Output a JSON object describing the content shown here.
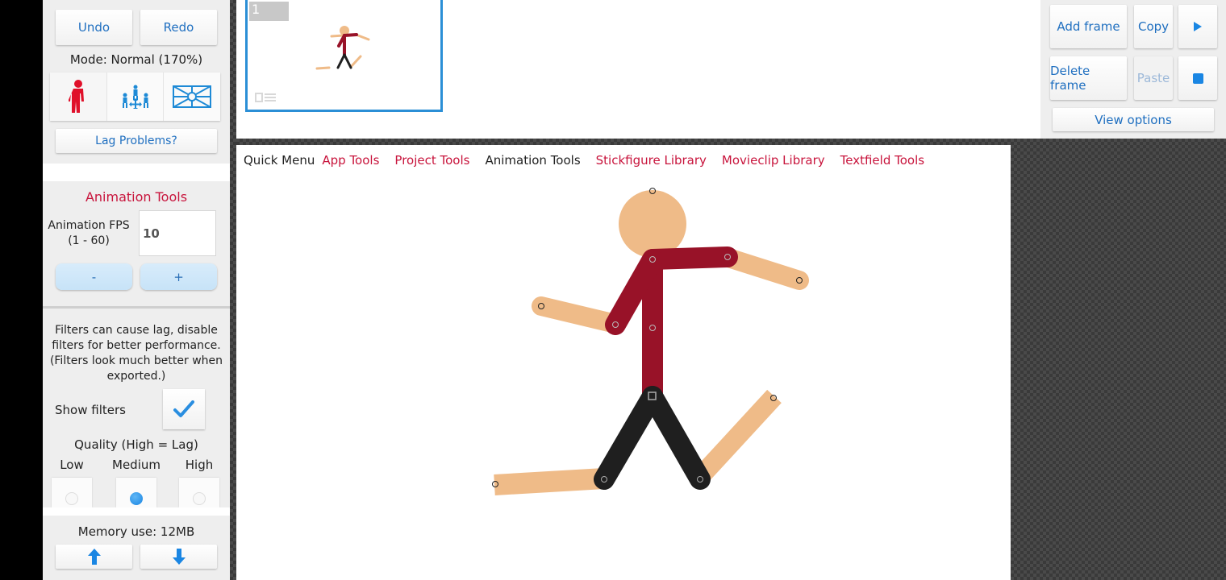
{
  "sidebar": {
    "undo_label": "Undo",
    "redo_label": "Redo",
    "mode_text": "Mode: Normal (170%)",
    "mode_buttons": [
      {
        "name": "stickfigure-mode",
        "icon": "stickfigure-icon",
        "active": true
      },
      {
        "name": "group-mode",
        "icon": "group-move-icon",
        "active": false
      },
      {
        "name": "background-mode",
        "icon": "background-scene-icon",
        "active": false
      }
    ],
    "lag_label": "Lag Problems?",
    "animation_tools": {
      "title": "Animation Tools",
      "fps_label_line1": "Animation FPS",
      "fps_label_line2": "(1 - 60)",
      "fps_value": "10",
      "minus_label": "-",
      "plus_label": "+"
    },
    "filters": {
      "note_line1": "Filters can cause lag, disable",
      "note_line2": "filters for better performance.",
      "note_line3": "(Filters look much better when",
      "note_line4": "exported.)",
      "show_filters_label": "Show filters",
      "show_filters_checked": true,
      "quality_label": "Quality (High = Lag)",
      "quality_options": [
        "Low",
        "Medium",
        "High"
      ],
      "quality_selected": "Medium"
    },
    "memory_text": "Memory use: 12MB",
    "up_icon": "arrow-up-icon",
    "down_icon": "arrow-down-icon"
  },
  "frames": {
    "items": [
      {
        "number": "1",
        "selected": true
      }
    ]
  },
  "top_right": {
    "add_frame_label": "Add frame",
    "copy_label": "Copy",
    "play_icon": "play-icon",
    "delete_frame_label": "Delete frame",
    "paste_label": "Paste",
    "stop_icon": "stop-icon",
    "view_options_label": "View options"
  },
  "menu": {
    "quick_menu": "Quick Menu",
    "items": [
      {
        "label": "App Tools",
        "active": false
      },
      {
        "label": "Project Tools",
        "active": false
      },
      {
        "label": "Animation Tools",
        "active": true
      },
      {
        "label": "Stickfigure Library",
        "active": false
      },
      {
        "label": "Movieclip Library",
        "active": false
      },
      {
        "label": "Textfield Tools",
        "active": false
      }
    ]
  },
  "colors": {
    "skin": "#efbb88",
    "shirt": "#981228",
    "pants": "#1f1f1f",
    "accent_red": "#c8143c",
    "accent_blue": "#1f6fc0",
    "frame_border": "#2b8fd6"
  }
}
